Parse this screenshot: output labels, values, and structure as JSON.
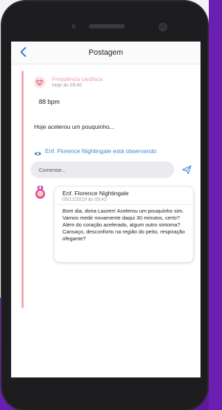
{
  "header": {
    "title": "Postagem"
  },
  "post": {
    "category": "Frequência cardíaca",
    "time": "Hoje às 09:40",
    "value": "88 bpm",
    "description": "Hoje acelerou um pouquinho...",
    "watching": "Enf. Florence Nightingale está observando"
  },
  "comment": {
    "placeholder": "Comentar..."
  },
  "reply": {
    "author": "Enf. Florence Nightingale",
    "timestamp": "05/12/2019 às 09:42",
    "text": "Bom dia, dona Lauren! Acelerou um pouquinho sim. Vamos medir novamente daqui 30 minutos, certo? Além do coração acelerado, algum outro sintoma? Cansaço, desconforto na região do peito, respiração ofegante?"
  },
  "colors": {
    "accent": "#f2a9b2",
    "link": "#3a86d2",
    "background": "#6b1fb0"
  },
  "icons": {
    "back": "chevron-left-icon",
    "category": "heart-rate-icon",
    "watching": "eye-icon",
    "send": "send-icon",
    "avatar": "nurse-avatar"
  }
}
